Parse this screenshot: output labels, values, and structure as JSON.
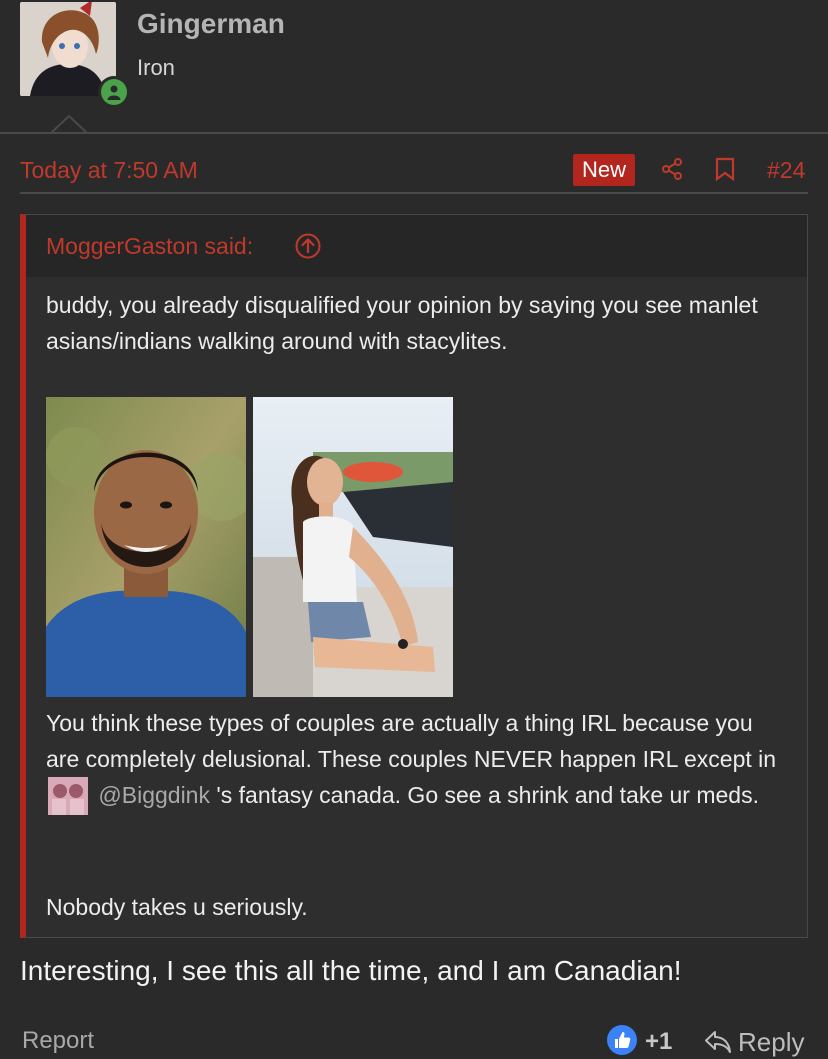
{
  "user": {
    "name": "Gingerman",
    "title": "Iron",
    "online_status": "online"
  },
  "post": {
    "time": "Today at 7:50 AM",
    "new_label": "New",
    "number": "#24",
    "icons": [
      "share-icon",
      "bookmark-icon"
    ]
  },
  "quote": {
    "author_label": "MoggerGaston said:",
    "paragraph1": "buddy, you already disqualified your opinion by saying you see manlet asians/indians walking around with stacylites.",
    "paragraph2_before": "You think these types of couples are actually a thing IRL because you are completely delusional. These couples NEVER happen IRL except in",
    "mention": "@Biggdink",
    "paragraph2_after": " 's fantasy canada. Go see a shrink and take ur meds.",
    "paragraph3": "Nobody takes u seriously."
  },
  "reply": {
    "text": "Interesting, I see this all the time, and I am Canadian!"
  },
  "footer": {
    "report_label": "Report",
    "like_count": "+1",
    "reply_label": "Reply"
  },
  "colors": {
    "accent_red": "#c0392b",
    "badge_red": "#b3261e",
    "background": "#2a2a2b",
    "online_green": "#4aa34a",
    "like_blue": "#3b82f6"
  }
}
